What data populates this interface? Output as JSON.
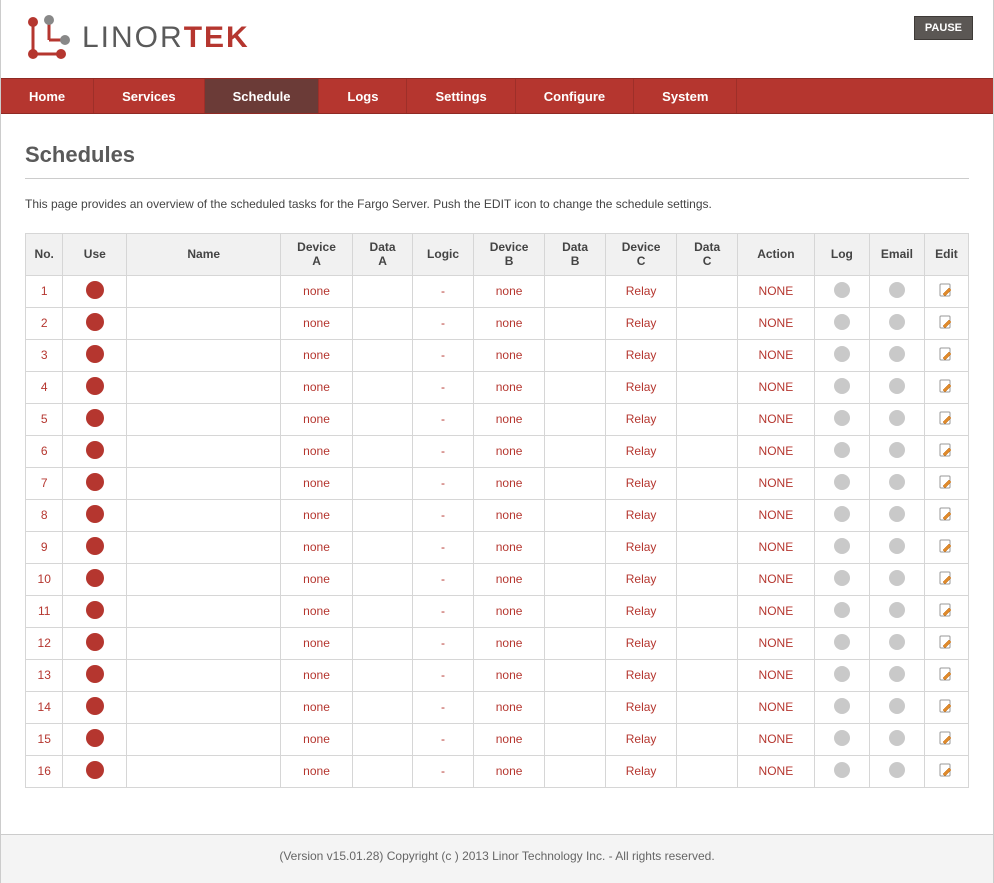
{
  "header": {
    "logo_text_a": "LINOR",
    "logo_text_b": "TEK",
    "pause_label": "PAUSE"
  },
  "nav": {
    "items": [
      {
        "label": "Home",
        "active": false
      },
      {
        "label": "Services",
        "active": false
      },
      {
        "label": "Schedule",
        "active": true
      },
      {
        "label": "Logs",
        "active": false
      },
      {
        "label": "Settings",
        "active": false
      },
      {
        "label": "Configure",
        "active": false
      },
      {
        "label": "System",
        "active": false
      }
    ]
  },
  "page": {
    "title": "Schedules",
    "intro": "This page provides an overview of the scheduled tasks for the Fargo Server. Push the EDIT icon to change the schedule settings."
  },
  "table": {
    "headers": {
      "no": "No.",
      "use": "Use",
      "name": "Name",
      "device_a": "Device A",
      "data_a": "Data A",
      "logic": "Logic",
      "device_b": "Device B",
      "data_b": "Data B",
      "device_c": "Device C",
      "data_c": "Data C",
      "action": "Action",
      "log": "Log",
      "email": "Email",
      "edit": "Edit"
    },
    "rows": [
      {
        "no": "1",
        "use": true,
        "name": "",
        "device_a": "none",
        "data_a": "",
        "logic": "-",
        "device_b": "none",
        "data_b": "",
        "device_c": "Relay",
        "data_c": "",
        "action": "NONE",
        "log": false,
        "email": false
      },
      {
        "no": "2",
        "use": true,
        "name": "",
        "device_a": "none",
        "data_a": "",
        "logic": "-",
        "device_b": "none",
        "data_b": "",
        "device_c": "Relay",
        "data_c": "",
        "action": "NONE",
        "log": false,
        "email": false
      },
      {
        "no": "3",
        "use": true,
        "name": "",
        "device_a": "none",
        "data_a": "",
        "logic": "-",
        "device_b": "none",
        "data_b": "",
        "device_c": "Relay",
        "data_c": "",
        "action": "NONE",
        "log": false,
        "email": false
      },
      {
        "no": "4",
        "use": true,
        "name": "",
        "device_a": "none",
        "data_a": "",
        "logic": "-",
        "device_b": "none",
        "data_b": "",
        "device_c": "Relay",
        "data_c": "",
        "action": "NONE",
        "log": false,
        "email": false
      },
      {
        "no": "5",
        "use": true,
        "name": "",
        "device_a": "none",
        "data_a": "",
        "logic": "-",
        "device_b": "none",
        "data_b": "",
        "device_c": "Relay",
        "data_c": "",
        "action": "NONE",
        "log": false,
        "email": false
      },
      {
        "no": "6",
        "use": true,
        "name": "",
        "device_a": "none",
        "data_a": "",
        "logic": "-",
        "device_b": "none",
        "data_b": "",
        "device_c": "Relay",
        "data_c": "",
        "action": "NONE",
        "log": false,
        "email": false
      },
      {
        "no": "7",
        "use": true,
        "name": "",
        "device_a": "none",
        "data_a": "",
        "logic": "-",
        "device_b": "none",
        "data_b": "",
        "device_c": "Relay",
        "data_c": "",
        "action": "NONE",
        "log": false,
        "email": false
      },
      {
        "no": "8",
        "use": true,
        "name": "",
        "device_a": "none",
        "data_a": "",
        "logic": "-",
        "device_b": "none",
        "data_b": "",
        "device_c": "Relay",
        "data_c": "",
        "action": "NONE",
        "log": false,
        "email": false
      },
      {
        "no": "9",
        "use": true,
        "name": "",
        "device_a": "none",
        "data_a": "",
        "logic": "-",
        "device_b": "none",
        "data_b": "",
        "device_c": "Relay",
        "data_c": "",
        "action": "NONE",
        "log": false,
        "email": false
      },
      {
        "no": "10",
        "use": true,
        "name": "",
        "device_a": "none",
        "data_a": "",
        "logic": "-",
        "device_b": "none",
        "data_b": "",
        "device_c": "Relay",
        "data_c": "",
        "action": "NONE",
        "log": false,
        "email": false
      },
      {
        "no": "11",
        "use": true,
        "name": "",
        "device_a": "none",
        "data_a": "",
        "logic": "-",
        "device_b": "none",
        "data_b": "",
        "device_c": "Relay",
        "data_c": "",
        "action": "NONE",
        "log": false,
        "email": false
      },
      {
        "no": "12",
        "use": true,
        "name": "",
        "device_a": "none",
        "data_a": "",
        "logic": "-",
        "device_b": "none",
        "data_b": "",
        "device_c": "Relay",
        "data_c": "",
        "action": "NONE",
        "log": false,
        "email": false
      },
      {
        "no": "13",
        "use": true,
        "name": "",
        "device_a": "none",
        "data_a": "",
        "logic": "-",
        "device_b": "none",
        "data_b": "",
        "device_c": "Relay",
        "data_c": "",
        "action": "NONE",
        "log": false,
        "email": false
      },
      {
        "no": "14",
        "use": true,
        "name": "",
        "device_a": "none",
        "data_a": "",
        "logic": "-",
        "device_b": "none",
        "data_b": "",
        "device_c": "Relay",
        "data_c": "",
        "action": "NONE",
        "log": false,
        "email": false
      },
      {
        "no": "15",
        "use": true,
        "name": "",
        "device_a": "none",
        "data_a": "",
        "logic": "-",
        "device_b": "none",
        "data_b": "",
        "device_c": "Relay",
        "data_c": "",
        "action": "NONE",
        "log": false,
        "email": false
      },
      {
        "no": "16",
        "use": true,
        "name": "",
        "device_a": "none",
        "data_a": "",
        "logic": "-",
        "device_b": "none",
        "data_b": "",
        "device_c": "Relay",
        "data_c": "",
        "action": "NONE",
        "log": false,
        "email": false
      }
    ]
  },
  "footer": {
    "text": "(Version v15.01.28) Copyright (c ) 2013 Linor Technology Inc. - All rights reserved."
  }
}
